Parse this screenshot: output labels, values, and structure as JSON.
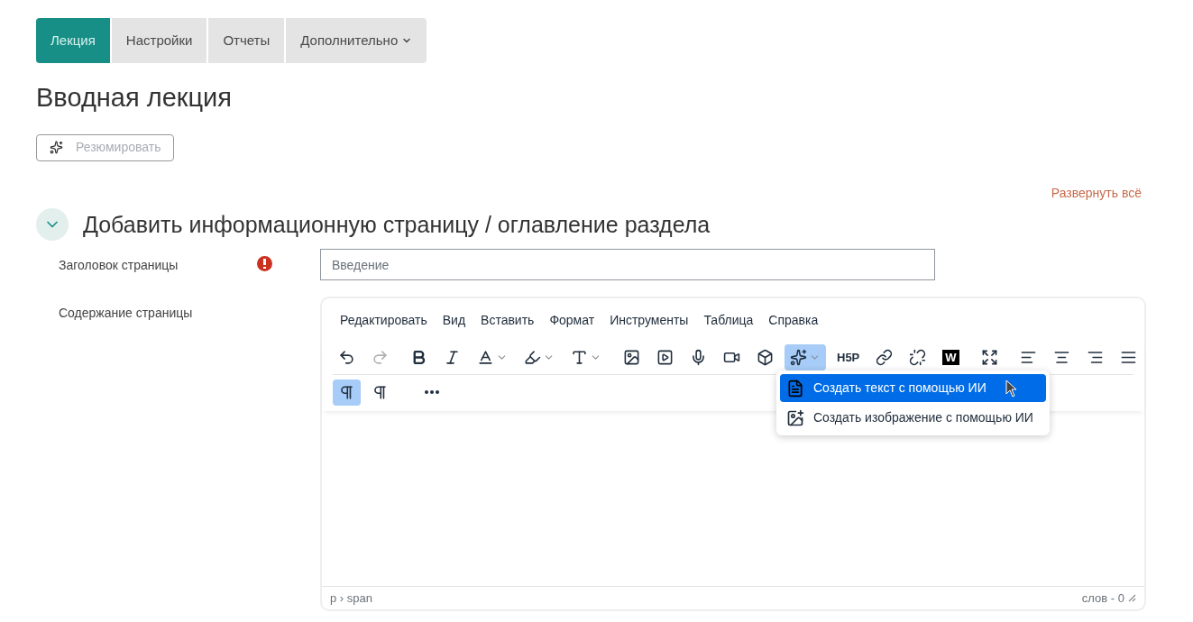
{
  "tabs": [
    {
      "label": "Лекция",
      "selected": true,
      "dropdown": false
    },
    {
      "label": "Настройки",
      "selected": false,
      "dropdown": false
    },
    {
      "label": "Отчеты",
      "selected": false,
      "dropdown": false
    },
    {
      "label": "Дополнительно",
      "selected": false,
      "dropdown": true
    }
  ],
  "title": "Вводная лекция",
  "summarize_button": {
    "label": "Резюмировать",
    "disabled": true
  },
  "expand_all": "Развернуть всё",
  "section": {
    "title": "Добавить информационную страницу / оглавление раздела",
    "expanded": true,
    "fields": [
      {
        "label": "Заголовок страницы",
        "required": true,
        "placeholder": "Введение"
      },
      {
        "label": "Содержание страницы",
        "required": false
      }
    ]
  },
  "editor": {
    "menu": [
      "Редактировать",
      "Вид",
      "Вставить",
      "Формат",
      "Инструменты",
      "Таблица",
      "Справка"
    ],
    "toolbar_rows": [
      [
        {
          "kind": "undo",
          "disabled": false,
          "selected": false
        },
        {
          "kind": "redo",
          "disabled": true,
          "selected": false
        },
        {
          "kind": "gap"
        },
        {
          "kind": "bold",
          "disabled": false,
          "selected": false
        },
        {
          "kind": "italic",
          "disabled": false,
          "selected": false
        },
        {
          "kind": "text-color",
          "disabled": false,
          "selected": false
        },
        {
          "kind": "highlight",
          "disabled": false,
          "selected": false
        },
        {
          "kind": "font-size",
          "disabled": false,
          "selected": false
        },
        {
          "kind": "gap"
        },
        {
          "kind": "image",
          "disabled": false,
          "selected": false
        },
        {
          "kind": "media",
          "disabled": false,
          "selected": false
        },
        {
          "kind": "mic",
          "disabled": false,
          "selected": false
        },
        {
          "kind": "video",
          "disabled": false,
          "selected": false
        },
        {
          "kind": "block",
          "disabled": false,
          "selected": false
        },
        {
          "kind": "ai",
          "disabled": false,
          "selected": true
        },
        {
          "kind": "h5p",
          "label": "H5P",
          "disabled": false,
          "selected": false
        },
        {
          "kind": "link",
          "disabled": false,
          "selected": false
        },
        {
          "kind": "unlink",
          "disabled": false,
          "selected": false
        },
        {
          "kind": "word",
          "label": "W",
          "disabled": false,
          "selected": false
        },
        {
          "kind": "gap"
        },
        {
          "kind": "fullscreen",
          "disabled": false,
          "selected": false
        },
        {
          "kind": "gap"
        },
        {
          "kind": "align-left",
          "disabled": false,
          "selected": false
        },
        {
          "kind": "align-center",
          "disabled": false,
          "selected": false
        },
        {
          "kind": "align-right",
          "disabled": false,
          "selected": false
        },
        {
          "kind": "align-justify",
          "disabled": false,
          "selected": false
        }
      ],
      [
        {
          "kind": "ltr",
          "disabled": false,
          "selected": true
        },
        {
          "kind": "rtl",
          "disabled": false,
          "selected": false
        },
        {
          "kind": "gap"
        },
        {
          "kind": "more",
          "disabled": false,
          "selected": false
        }
      ]
    ],
    "ai_menu": [
      {
        "kind": "text",
        "label": "Создать текст с помощью ИИ",
        "selected": true
      },
      {
        "kind": "image",
        "label": "Создать изображение с помощью ИИ",
        "selected": false
      }
    ],
    "path": "p › span",
    "word_count": "слов - 0"
  }
}
